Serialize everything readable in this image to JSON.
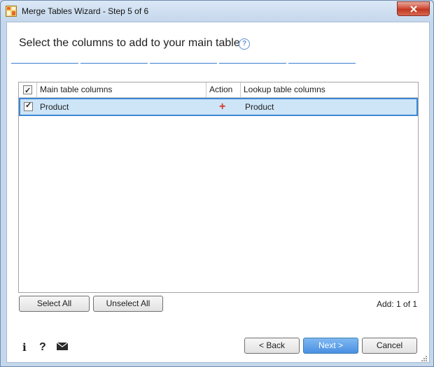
{
  "window": {
    "title": "Merge Tables Wizard - Step 5 of 6",
    "close_label": "✕"
  },
  "page": {
    "heading": "Select the columns to add to your main table",
    "help_glyph": "?"
  },
  "steps": {
    "count": 5,
    "active_color": "#3a7fcf"
  },
  "grid": {
    "headers": {
      "main": "Main table columns",
      "action": "Action",
      "lookup": "Lookup table columns"
    },
    "rows": [
      {
        "checked": true,
        "main": "Product",
        "action": "+",
        "lookup": "Product"
      }
    ]
  },
  "buttons": {
    "select_all": "Select All",
    "unselect_all": "Unselect All",
    "back": "< Back",
    "next": "Next >",
    "cancel": "Cancel"
  },
  "status": {
    "add_count": "Add: 1 of 1"
  },
  "footer_icons": {
    "info": "i",
    "help": "?",
    "mail": "envelope-icon"
  },
  "colors": {
    "accent": "#3d86d6",
    "selected_row": "#cde5f7",
    "plus": "#d53a2e"
  }
}
